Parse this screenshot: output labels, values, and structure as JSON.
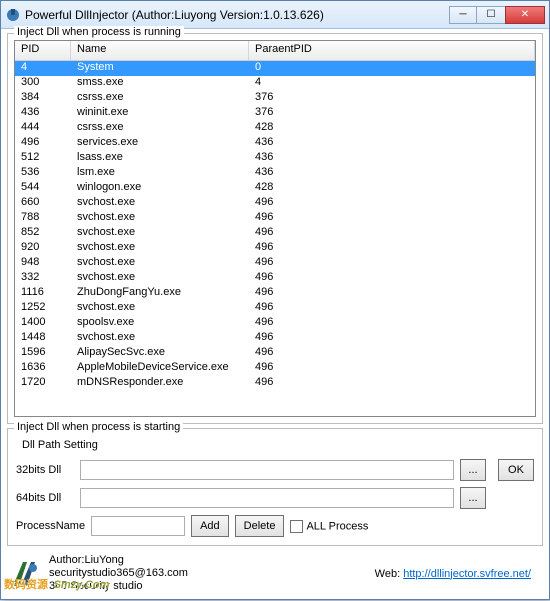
{
  "window": {
    "title": "Powerful DllInjector (Author:Liuyong Version:1.0.13.626)"
  },
  "group_running": {
    "title": "Inject Dll when process is running"
  },
  "columns": {
    "pid": "PID",
    "name": "Name",
    "ppid": "ParaentPID"
  },
  "rows": [
    {
      "pid": "4",
      "name": "System",
      "ppid": "0",
      "selected": true
    },
    {
      "pid": "300",
      "name": "smss.exe",
      "ppid": "4"
    },
    {
      "pid": "384",
      "name": "csrss.exe",
      "ppid": "376"
    },
    {
      "pid": "436",
      "name": "wininit.exe",
      "ppid": "376"
    },
    {
      "pid": "444",
      "name": "csrss.exe",
      "ppid": "428"
    },
    {
      "pid": "496",
      "name": "services.exe",
      "ppid": "436"
    },
    {
      "pid": "512",
      "name": "lsass.exe",
      "ppid": "436"
    },
    {
      "pid": "536",
      "name": "lsm.exe",
      "ppid": "436"
    },
    {
      "pid": "544",
      "name": "winlogon.exe",
      "ppid": "428"
    },
    {
      "pid": "660",
      "name": "svchost.exe",
      "ppid": "496"
    },
    {
      "pid": "788",
      "name": "svchost.exe",
      "ppid": "496"
    },
    {
      "pid": "852",
      "name": "svchost.exe",
      "ppid": "496"
    },
    {
      "pid": "920",
      "name": "svchost.exe",
      "ppid": "496"
    },
    {
      "pid": "948",
      "name": "svchost.exe",
      "ppid": "496"
    },
    {
      "pid": "332",
      "name": "svchost.exe",
      "ppid": "496"
    },
    {
      "pid": "1116",
      "name": "ZhuDongFangYu.exe",
      "ppid": "496"
    },
    {
      "pid": "1252",
      "name": "svchost.exe",
      "ppid": "496"
    },
    {
      "pid": "1400",
      "name": "spoolsv.exe",
      "ppid": "496"
    },
    {
      "pid": "1448",
      "name": "svchost.exe",
      "ppid": "496"
    },
    {
      "pid": "1596",
      "name": "AlipaySecSvc.exe",
      "ppid": "496"
    },
    {
      "pid": "1636",
      "name": "AppleMobileDeviceService.exe",
      "ppid": "496"
    },
    {
      "pid": "1720",
      "name": "mDNSResponder.exe",
      "ppid": "496"
    }
  ],
  "group_starting": {
    "title": "Inject Dll when process is starting"
  },
  "dll": {
    "setting_label": "Dll Path Setting",
    "label32": "32bits Dll",
    "label64": "64bits Dll",
    "val32": "",
    "val64": "",
    "browse": "...",
    "ok": "OK"
  },
  "proc": {
    "label": "ProcessName",
    "value": "",
    "add": "Add",
    "delete": "Delete",
    "all": "ALL Process"
  },
  "footer": {
    "author": "Author:LiuYong",
    "email": "securitystudio365@163.com",
    "studio": "365 Security studio",
    "web_label": "Web:",
    "web_url": "http://dllinjector.svfree.net/"
  },
  "watermark": {
    "cn": "数码资源",
    "en": "Smzy.Com"
  }
}
